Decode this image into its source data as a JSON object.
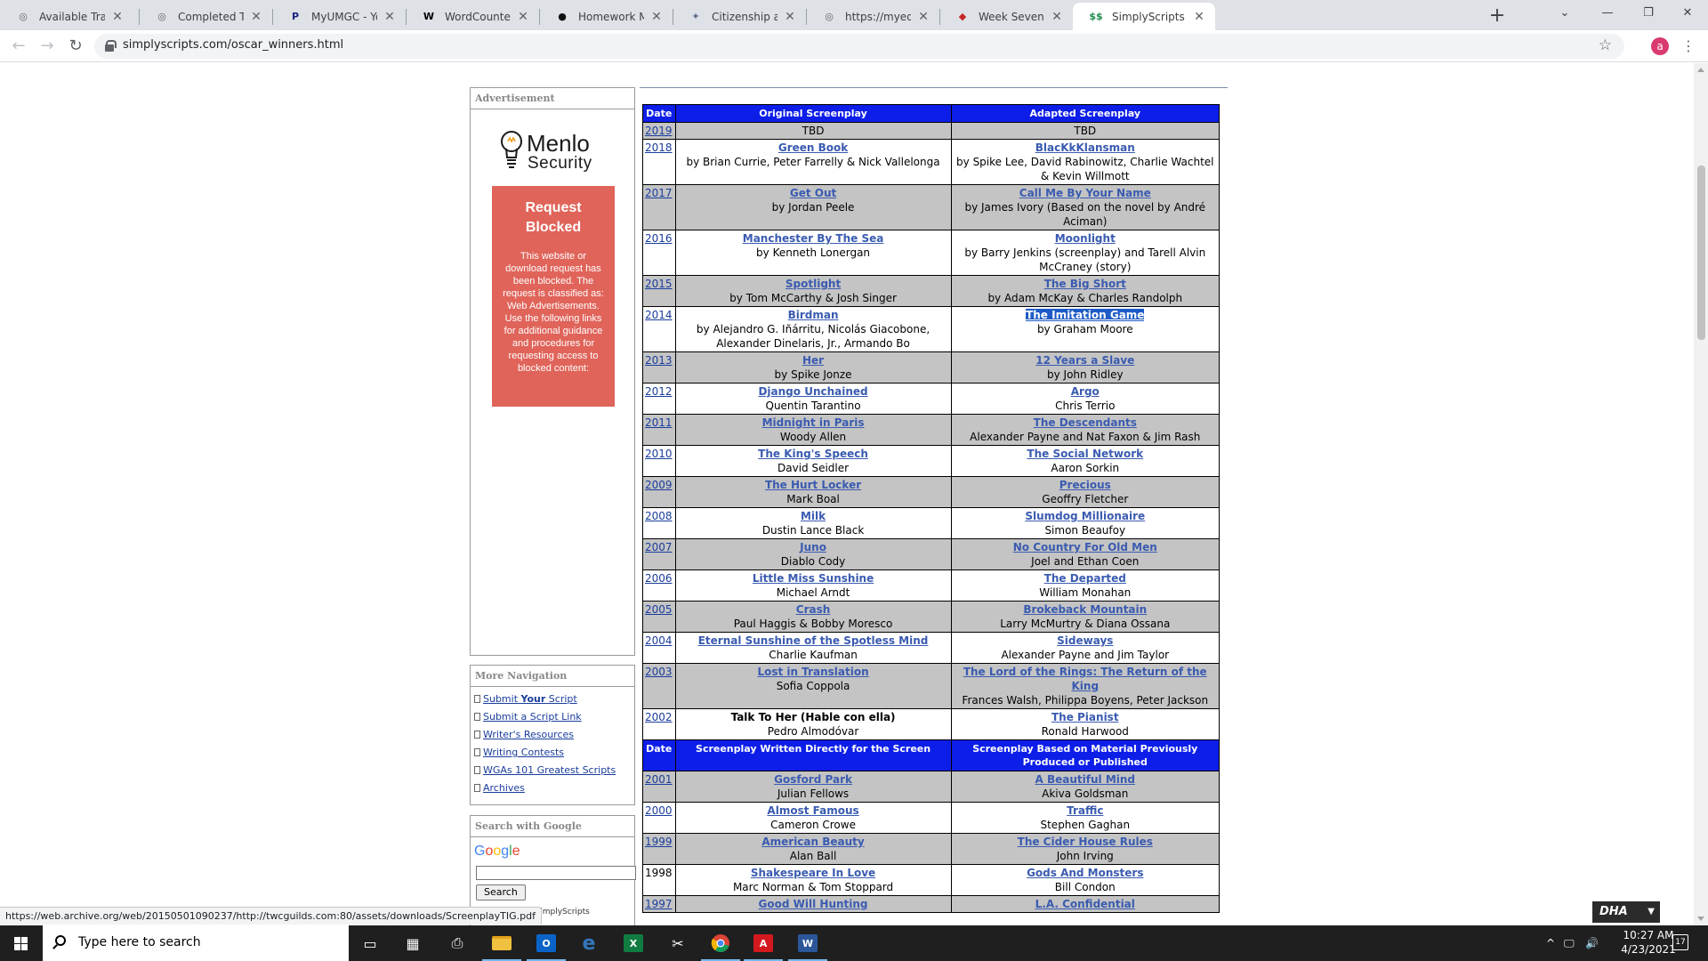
{
  "browser": {
    "tabs": [
      {
        "title": "Available Training",
        "favicon": "globe-icon",
        "glyph": "◎"
      },
      {
        "title": "Completed Training",
        "favicon": "globe-icon",
        "glyph": "◎"
      },
      {
        "title": "MyUMGC - Your MyU…",
        "favicon": "p-logo-icon",
        "glyph": "P"
      },
      {
        "title": "WordCounter - Count…",
        "favicon": "w-logo-icon",
        "glyph": "W"
      },
      {
        "title": "Homework Market",
        "favicon": "hm-logo-icon",
        "glyph": "●"
      },
      {
        "title": "Citizenship and Immig…",
        "favicon": "seal-icon",
        "glyph": "✦"
      },
      {
        "title": "https://myeducation.n…",
        "favicon": "globe-icon",
        "glyph": "◎"
      },
      {
        "title": "Week Seven: Cinema i…",
        "favicon": "shield-logo-icon",
        "glyph": "◆"
      },
      {
        "title": "SimplyScripts - Oscar …",
        "favicon": "ss-logo-icon",
        "glyph": "$$"
      }
    ],
    "url": "simplyscripts.com/oscar_winners.html",
    "profile_initial": "a",
    "status_url": "https://web.archive.org/web/20150501090237/http://twcguilds.com:80/assets/downloads/ScreenplayTIG.pdf"
  },
  "sidebar": {
    "ad_header": "Advertisement",
    "menlo_line1": "Menlo",
    "menlo_line2": "Security",
    "blocked_title": "Request Blocked",
    "blocked_body": "This website or download request has been blocked. The request is classified as: Web Advertisements. Use the following links for additional guidance and procedures for requesting access to blocked content:",
    "nav_header": "More Navigation",
    "nav_items": [
      {
        "pre": "Submit ",
        "bold": "Your",
        "post": " Script"
      },
      {
        "pre": "Submit a Script Link",
        "bold": "",
        "post": ""
      },
      {
        "pre": "Writer's Resources",
        "bold": "",
        "post": ""
      },
      {
        "pre": "Writing Contests",
        "bold": "",
        "post": ""
      },
      {
        "pre": "WGAs 101 Greatest Scripts",
        "bold": "",
        "post": ""
      },
      {
        "pre": "Archives",
        "bold": "",
        "post": ""
      }
    ],
    "google_header": "Search with Google",
    "google_letters": [
      {
        "ch": "G",
        "color": "#4285f4"
      },
      {
        "ch": "o",
        "color": "#ea4335"
      },
      {
        "ch": "o",
        "color": "#fbbc05"
      },
      {
        "ch": "g",
        "color": "#4285f4"
      },
      {
        "ch": "l",
        "color": "#34a853"
      },
      {
        "ch": "e",
        "color": "#ea4335"
      }
    ],
    "search_button": "Search",
    "search_site": "arch SimplyScripts"
  },
  "table": {
    "headers": [
      "Date",
      "Original Screenplay",
      "Adapted Screenplay"
    ],
    "headers2": [
      "Date",
      "Screenplay Written Directly for the Screen",
      "Screenplay Based on Material Previously Produced or Published"
    ],
    "rows": [
      {
        "year": "2019",
        "year_link": true,
        "o_title": "",
        "o_by": "TBD",
        "a_title": "",
        "a_by": "TBD"
      },
      {
        "year": "2018",
        "year_link": true,
        "o_title": "Green Book",
        "o_by": "by Brian Currie, Peter Farrelly & Nick Vallelonga",
        "a_title": "BlacKkKlansman",
        "a_by": "by Spike Lee, David Rabinowitz, Charlie Wachtel & Kevin Willmott"
      },
      {
        "year": "2017",
        "year_link": true,
        "o_title": "Get Out",
        "o_by": "by Jordan Peele",
        "a_title": "Call Me By Your Name",
        "a_by": "by James Ivory (Based on the novel by André Aciman)"
      },
      {
        "year": "2016",
        "year_link": true,
        "o_title": "Manchester By The Sea",
        "o_by": "by Kenneth Lonergan",
        "a_title": "Moonlight",
        "a_by": "by Barry Jenkins (screenplay) and Tarell Alvin McCraney (story)"
      },
      {
        "year": "2015",
        "year_link": true,
        "o_title": "Spotlight",
        "o_by": "by Tom McCarthy & Josh Singer",
        "a_title": "The Big Short",
        "a_by": "by Adam McKay & Charles Randolph"
      },
      {
        "year": "2014",
        "year_link": true,
        "o_title": "Birdman",
        "o_by": "by Alejandro G. Iñárritu, Nicolás Giacobone, Alexander Dinelaris, Jr., Armando Bo",
        "a_title": "The Imitation Game",
        "a_by": "by Graham Moore",
        "a_sel": true
      },
      {
        "year": "2013",
        "year_link": true,
        "o_title": "Her",
        "o_by": "by Spike Jonze",
        "a_title": "12 Years a Slave",
        "a_by": "by John Ridley"
      },
      {
        "year": "2012",
        "year_link": true,
        "o_title": "Django Unchained",
        "o_by": "Quentin Tarantino",
        "a_title": "Argo",
        "a_by": "Chris Terrio"
      },
      {
        "year": "2011",
        "year_link": true,
        "o_title": "Midnight in Paris",
        "o_by": "Woody Allen",
        "a_title": "The Descendants",
        "a_by": "Alexander Payne and Nat Faxon & Jim Rash"
      },
      {
        "year": "2010",
        "year_link": true,
        "o_title": "The King's Speech",
        "o_by": "David Seidler",
        "a_title": "The Social Network",
        "a_by": "Aaron Sorkin"
      },
      {
        "year": "2009",
        "year_link": true,
        "o_title": "The Hurt Locker",
        "o_by": "Mark Boal",
        "a_title": "Precious",
        "a_by": "Geoffry Fletcher"
      },
      {
        "year": "2008",
        "year_link": true,
        "o_title": "Milk",
        "o_by": "Dustin Lance Black",
        "a_title": "Slumdog Millionaire",
        "a_by": "Simon Beaufoy"
      },
      {
        "year": "2007",
        "year_link": true,
        "o_title": "Juno",
        "o_by": "Diablo Cody",
        "a_title": "No Country For Old Men",
        "a_by": "Joel and Ethan Coen"
      },
      {
        "year": "2006",
        "year_link": true,
        "o_title": "Little Miss Sunshine",
        "o_by": "Michael Arndt",
        "a_title": "The Departed",
        "a_by": "William Monahan"
      },
      {
        "year": "2005",
        "year_link": true,
        "o_title": "Crash",
        "o_by": "Paul Haggis & Bobby Moresco",
        "a_title": "Brokeback Mountain",
        "a_by": "Larry McMurtry & Diana Ossana"
      },
      {
        "year": "2004",
        "year_link": true,
        "o_title": "Eternal Sunshine of the Spotless Mind",
        "o_by": "Charlie Kaufman",
        "a_title": "Sideways",
        "a_by": "Alexander Payne and Jim Taylor"
      },
      {
        "year": "2003",
        "year_link": true,
        "o_title": "Lost in Translation",
        "o_by": "Sofia Coppola",
        "a_title": "The Lord of the Rings: The Return of the King",
        "a_by": "Frances Walsh, Philippa Boyens, Peter Jackson"
      },
      {
        "year": "2002",
        "year_link": true,
        "o_title": "Talk To Her (Hable con ella)",
        "o_plain": true,
        "o_by": "Pedro Almodóvar",
        "a_title": "The Pianist",
        "a_by": "Ronald Harwood"
      }
    ],
    "rows2": [
      {
        "year": "2001",
        "year_link": true,
        "o_title": "Gosford Park",
        "o_by": "Julian Fellows",
        "a_title": "A Beautiful Mind",
        "a_by": "Akiva Goldsman"
      },
      {
        "year": "2000",
        "year_link": true,
        "o_title": "Almost Famous",
        "o_by": "Cameron Crowe",
        "a_title": "Traffic",
        "a_by": "Stephen Gaghan"
      },
      {
        "year": "1999",
        "year_link": true,
        "o_title": "American Beauty",
        "o_by": "Alan Ball",
        "a_title": "The Cider House Rules",
        "a_by": "John Irving"
      },
      {
        "year": "1998",
        "year_link": false,
        "o_title": "Shakespeare In Love",
        "o_by": "Marc Norman & Tom Stoppard",
        "a_title": "Gods And Monsters",
        "a_by": "Bill Condon"
      },
      {
        "year": "1997",
        "year_link": true,
        "o_title": "Good Will Hunting",
        "o_by": "",
        "a_title": "L.A. Confidential",
        "a_by": ""
      }
    ]
  },
  "taskbar": {
    "search_placeholder": "Type here to search",
    "time": "10:27 AM",
    "date": "4/23/2021",
    "notif_count": "17",
    "apps": [
      {
        "name": "task-view-icon",
        "glyph": "▭",
        "color": "transparent"
      },
      {
        "name": "calculator-icon",
        "glyph": "▦",
        "color": "transparent"
      },
      {
        "name": "printer-icon",
        "glyph": "⎙",
        "color": "transparent"
      },
      {
        "name": "file-explorer-icon",
        "glyph": "",
        "color": "#f0c040"
      },
      {
        "name": "outlook-icon",
        "glyph": "O",
        "color": "#0a64c8"
      },
      {
        "name": "edge-icon",
        "glyph": "e",
        "color": "transparent"
      },
      {
        "name": "excel-icon",
        "glyph": "X",
        "color": "#107c41"
      },
      {
        "name": "snip-icon",
        "glyph": "✂",
        "color": "transparent"
      },
      {
        "name": "chrome-icon",
        "glyph": "",
        "color": "transparent"
      },
      {
        "name": "acrobat-icon",
        "glyph": "A",
        "color": "#d4191e"
      },
      {
        "name": "word-icon",
        "glyph": "W",
        "color": "#2b579a"
      }
    ],
    "dha_label": "DHA"
  }
}
